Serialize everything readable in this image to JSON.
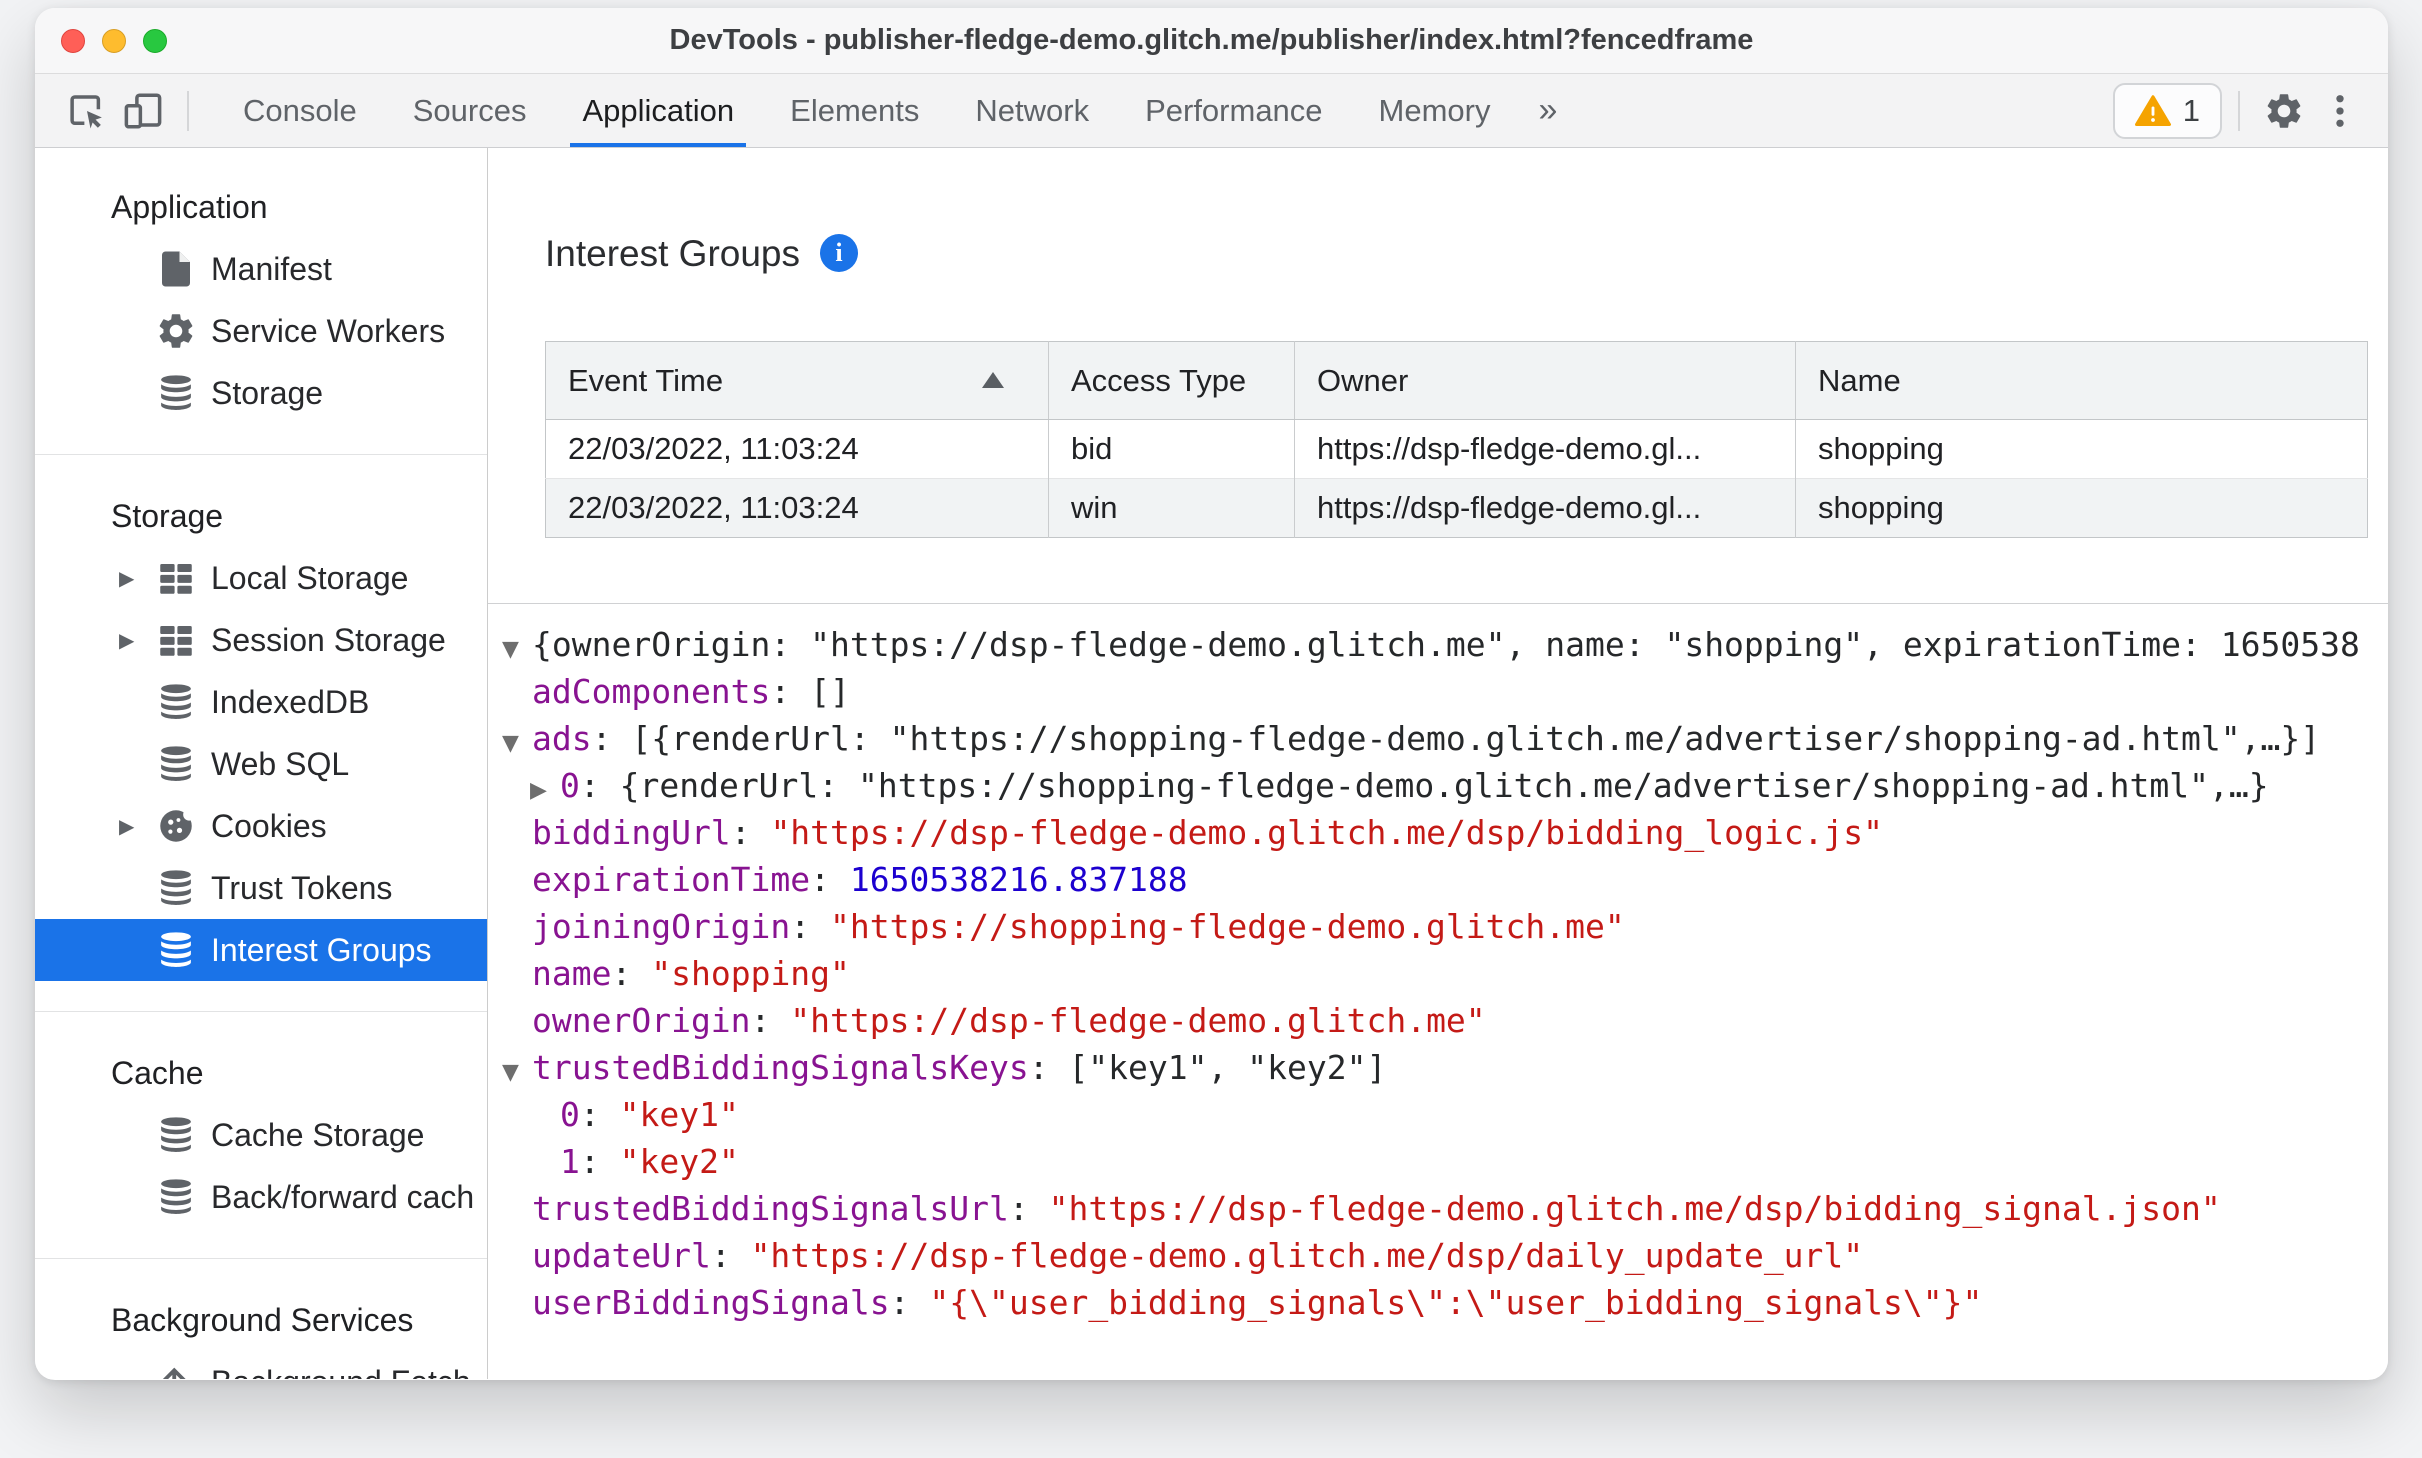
{
  "window": {
    "title": "DevTools - publisher-fledge-demo.glitch.me/publisher/index.html?fencedframe"
  },
  "toolbar": {
    "tabs": [
      {
        "label": "Console",
        "active": false
      },
      {
        "label": "Sources",
        "active": false
      },
      {
        "label": "Application",
        "active": true
      },
      {
        "label": "Elements",
        "active": false
      },
      {
        "label": "Network",
        "active": false
      },
      {
        "label": "Performance",
        "active": false
      },
      {
        "label": "Memory",
        "active": false
      }
    ],
    "more_tabs_glyph": "»",
    "warning_count": "1",
    "icons": [
      "inspect-icon",
      "device-toolbar-icon",
      "warning-icon",
      "gear-icon",
      "kebab-menu-icon"
    ]
  },
  "sidebar": {
    "sections": [
      {
        "header": "Application",
        "items": [
          {
            "label": "Manifest",
            "icon": "document-icon",
            "expander": false,
            "selected": false
          },
          {
            "label": "Service Workers",
            "icon": "gear-icon",
            "expander": false,
            "selected": false
          },
          {
            "label": "Storage",
            "icon": "database-icon",
            "expander": false,
            "selected": false
          }
        ]
      },
      {
        "header": "Storage",
        "items": [
          {
            "label": "Local Storage",
            "icon": "table-icon",
            "expander": true,
            "selected": false
          },
          {
            "label": "Session Storage",
            "icon": "table-icon",
            "expander": true,
            "selected": false
          },
          {
            "label": "IndexedDB",
            "icon": "database-icon",
            "expander": false,
            "selected": false
          },
          {
            "label": "Web SQL",
            "icon": "database-icon",
            "expander": false,
            "selected": false
          },
          {
            "label": "Cookies",
            "icon": "cookie-icon",
            "expander": true,
            "selected": false
          },
          {
            "label": "Trust Tokens",
            "icon": "database-icon",
            "expander": false,
            "selected": false
          },
          {
            "label": "Interest Groups",
            "icon": "database-icon",
            "expander": false,
            "selected": true
          }
        ]
      },
      {
        "header": "Cache",
        "items": [
          {
            "label": "Cache Storage",
            "icon": "database-icon",
            "expander": false,
            "selected": false
          },
          {
            "label": "Back/forward cach",
            "icon": "database-icon",
            "expander": false,
            "selected": false
          }
        ]
      },
      {
        "header": "Background Services",
        "items": [
          {
            "label": "Background Fetch",
            "icon": "fetch-icon",
            "expander": false,
            "selected": false
          }
        ]
      }
    ]
  },
  "main": {
    "title": "Interest Groups",
    "table": {
      "columns": [
        {
          "label": "Event Time",
          "sort": "asc"
        },
        {
          "label": "Access Type",
          "sort": null
        },
        {
          "label": "Owner",
          "sort": null
        },
        {
          "label": "Name",
          "sort": null
        }
      ],
      "rows": [
        [
          "22/03/2022, 11:03:24",
          "bid",
          "https://dsp-fledge-demo.gl...",
          "shopping"
        ],
        [
          "22/03/2022, 11:03:24",
          "win",
          "https://dsp-fledge-demo.gl...",
          "shopping"
        ]
      ]
    },
    "tree": [
      {
        "indent": 0,
        "arrow": "down",
        "segments": [
          {
            "type": "plain",
            "text": "{ownerOrigin: \"https://dsp-fledge-demo.glitch.me\", name: \"shopping\", expirationTime: 1650538"
          }
        ]
      },
      {
        "indent": 1,
        "arrow": null,
        "segments": [
          {
            "type": "key",
            "text": "adComponents"
          },
          {
            "type": "plain",
            "text": ": []"
          }
        ]
      },
      {
        "indent": 1,
        "arrow": "down",
        "segments": [
          {
            "type": "key",
            "text": "ads"
          },
          {
            "type": "plain",
            "text": ": [{renderUrl: \"https://shopping-fledge-demo.glitch.me/advertiser/shopping-ad.html\",…}]"
          }
        ]
      },
      {
        "indent": 2,
        "arrow": "right",
        "segments": [
          {
            "type": "key",
            "text": "0"
          },
          {
            "type": "plain",
            "text": ": {renderUrl: \"https://shopping-fledge-demo.glitch.me/advertiser/shopping-ad.html\",…}"
          }
        ]
      },
      {
        "indent": 1,
        "arrow": null,
        "segments": [
          {
            "type": "key",
            "text": "biddingUrl"
          },
          {
            "type": "plain",
            "text": ": "
          },
          {
            "type": "string",
            "text": "\"https://dsp-fledge-demo.glitch.me/dsp/bidding_logic.js\""
          }
        ]
      },
      {
        "indent": 1,
        "arrow": null,
        "segments": [
          {
            "type": "key",
            "text": "expirationTime"
          },
          {
            "type": "plain",
            "text": ": "
          },
          {
            "type": "number",
            "text": "1650538216.837188"
          }
        ]
      },
      {
        "indent": 1,
        "arrow": null,
        "segments": [
          {
            "type": "key",
            "text": "joiningOrigin"
          },
          {
            "type": "plain",
            "text": ": "
          },
          {
            "type": "string",
            "text": "\"https://shopping-fledge-demo.glitch.me\""
          }
        ]
      },
      {
        "indent": 1,
        "arrow": null,
        "segments": [
          {
            "type": "key",
            "text": "name"
          },
          {
            "type": "plain",
            "text": ": "
          },
          {
            "type": "string",
            "text": "\"shopping\""
          }
        ]
      },
      {
        "indent": 1,
        "arrow": null,
        "segments": [
          {
            "type": "key",
            "text": "ownerOrigin"
          },
          {
            "type": "plain",
            "text": ": "
          },
          {
            "type": "string",
            "text": "\"https://dsp-fledge-demo.glitch.me\""
          }
        ]
      },
      {
        "indent": 1,
        "arrow": "down",
        "segments": [
          {
            "type": "key",
            "text": "trustedBiddingSignalsKeys"
          },
          {
            "type": "plain",
            "text": ": [\"key1\", \"key2\"]"
          }
        ]
      },
      {
        "indent": 2,
        "arrow": null,
        "segments": [
          {
            "type": "key",
            "text": "0"
          },
          {
            "type": "plain",
            "text": ": "
          },
          {
            "type": "string",
            "text": "\"key1\""
          }
        ]
      },
      {
        "indent": 2,
        "arrow": null,
        "segments": [
          {
            "type": "key",
            "text": "1"
          },
          {
            "type": "plain",
            "text": ": "
          },
          {
            "type": "string",
            "text": "\"key2\""
          }
        ]
      },
      {
        "indent": 1,
        "arrow": null,
        "segments": [
          {
            "type": "key",
            "text": "trustedBiddingSignalsUrl"
          },
          {
            "type": "plain",
            "text": ": "
          },
          {
            "type": "string",
            "text": "\"https://dsp-fledge-demo.glitch.me/dsp/bidding_signal.json\""
          }
        ]
      },
      {
        "indent": 1,
        "arrow": null,
        "segments": [
          {
            "type": "key",
            "text": "updateUrl"
          },
          {
            "type": "plain",
            "text": ": "
          },
          {
            "type": "string",
            "text": "\"https://dsp-fledge-demo.glitch.me/dsp/daily_update_url\""
          }
        ]
      },
      {
        "indent": 1,
        "arrow": null,
        "segments": [
          {
            "type": "key",
            "text": "userBiddingSignals"
          },
          {
            "type": "plain",
            "text": ": "
          },
          {
            "type": "string",
            "text": "\"{\\\"user_bidding_signals\\\":\\\"user_bidding_signals\\\"}\""
          }
        ]
      }
    ]
  },
  "colors": {
    "accent": "#1a73e8",
    "selection_bg": "#1a73e8",
    "syntax_key": "#881391",
    "syntax_string": "#c41a16",
    "syntax_number": "#1c00cf",
    "warning": "#f5a300",
    "traffic_red": "#ff5f57",
    "traffic_yellow": "#febc2e",
    "traffic_green": "#28c840"
  }
}
